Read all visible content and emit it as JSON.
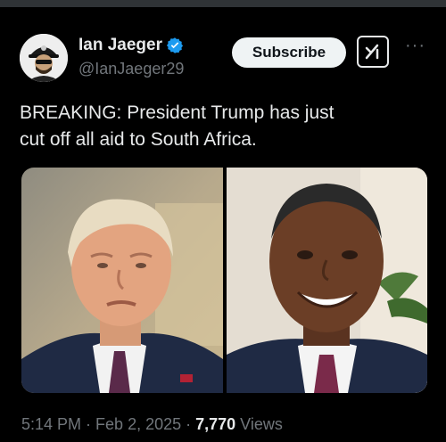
{
  "author": {
    "name": "Ian Jaeger",
    "handle": "@IanJaeger29",
    "verified": true
  },
  "actions": {
    "subscribe_label": "Subscribe",
    "grok_icon": "grok-icon",
    "more_icon": "more-icon"
  },
  "tweet": {
    "text_line1": "BREAKING: President Trump has just",
    "text_line2": "cut off all aid to South Africa."
  },
  "media": {
    "photos": [
      "trump-portrait",
      "ramaphosa-portrait"
    ]
  },
  "meta": {
    "time": "5:14 PM",
    "sep1": " · ",
    "date": "Feb 2, 2025",
    "sep2": " · ",
    "views_count": "7,770",
    "views_label": " Views"
  },
  "colors": {
    "background": "#000000",
    "text": "#e7e9ea",
    "secondary": "#71767b",
    "verified": "#1d9bf0"
  }
}
